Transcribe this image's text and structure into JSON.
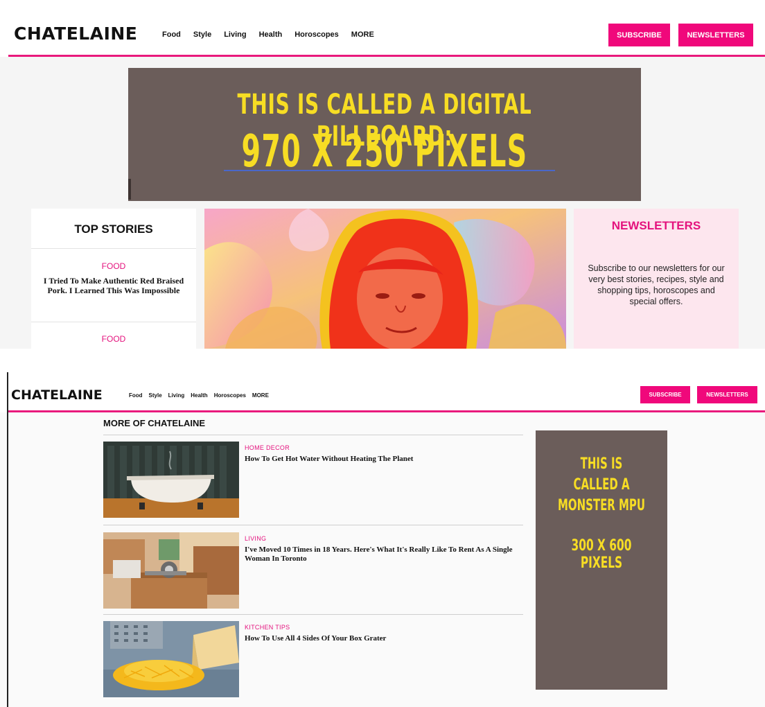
{
  "brand": {
    "logo": "CHATELAINE"
  },
  "nav": {
    "items": [
      "Food",
      "Style",
      "Living",
      "Health",
      "Horoscopes",
      "MORE"
    ],
    "subscribe": "SUBSCRIBE",
    "newsletters": "NEWSLETTERS"
  },
  "billboard": {
    "line1": "THIS IS CALLED A DIGITAL BILLBOARD:",
    "line2": "970 X 250 PIXELS"
  },
  "top_stories": {
    "heading": "TOP STORIES",
    "items": [
      {
        "category": "FOOD",
        "title": "I Tried To Make Authentic Red Braised Pork. I Learned This Was Impossible"
      },
      {
        "category": "FOOD",
        "title": ""
      }
    ]
  },
  "newsletter_box": {
    "heading": "NEWSLETTERS",
    "text": "Subscribe to our newsletters for our very best stories, recipes, style and shopping tips, horoscopes and special offers."
  },
  "more_section": {
    "title": "MORE OF CHATELAINE",
    "articles": [
      {
        "category": "HOME DECOR",
        "title": "How To Get Hot Water Without Heating The Planet",
        "image": "clawfoot-bathtub"
      },
      {
        "category": "LIVING",
        "title": "I've Moved 10 Times in 18 Years. Here's What It's Really Like To Rent As A Single Woman In Toronto",
        "image": "moving-boxes"
      },
      {
        "category": "KITCHEN TIPS",
        "title": "How To Use All 4 Sides Of Your Box Grater",
        "image": "grated-cheese"
      }
    ]
  },
  "mpu": {
    "line1": "THIS IS CALLED A MONSTER MPU",
    "line2": "300 X 600 PIXELS"
  },
  "colors": {
    "accent": "#f0087b",
    "ad_background": "#6b5d5a",
    "ad_text": "#f7dd24",
    "newsletter_background": "#fde6ee"
  }
}
